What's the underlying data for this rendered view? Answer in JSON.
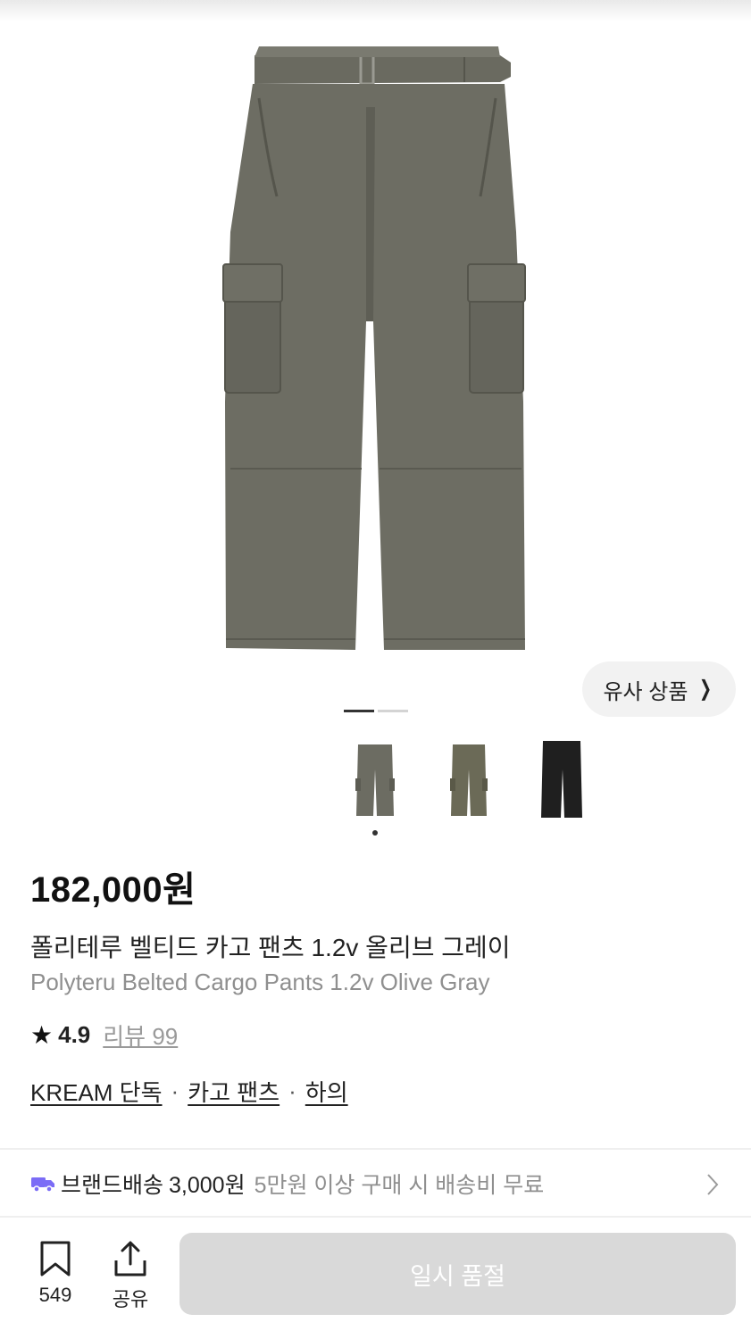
{
  "hero": {
    "similar_button_label": "유사 상품",
    "similar_button_icon": "chevron-right-icon"
  },
  "thumbnails": [
    {
      "name": "olive-gray",
      "color": "#6c6c62"
    },
    {
      "name": "olive",
      "color": "#6b6a57"
    },
    {
      "name": "black",
      "color": "#1f1f1f"
    }
  ],
  "product": {
    "price": "182,000원",
    "name_ko": "폴리테루 벨티드 카고 팬츠 1.2v 올리브 그레이",
    "name_en": "Polyteru Belted Cargo Pants 1.2v Olive Gray",
    "rating": "4.9",
    "review_label": "리뷰 99",
    "tags": [
      "KREAM 단독",
      "카고 팬츠",
      "하의"
    ],
    "tag_separator": "·"
  },
  "shipping": {
    "label": "브랜드배송",
    "fee": "3,000원",
    "note": "5만원 이상 구매 시 배송비 무료",
    "icon": "truck-icon",
    "icon_color": "#7b6cf6"
  },
  "bottom_bar": {
    "bookmark_count": "549",
    "share_label": "공유",
    "buy_button_label": "일시 품절",
    "buy_button_color": "#d9d9d9"
  },
  "colors": {
    "pants_main": "#6d6d63",
    "pants_shadow": "#5c5c53"
  }
}
